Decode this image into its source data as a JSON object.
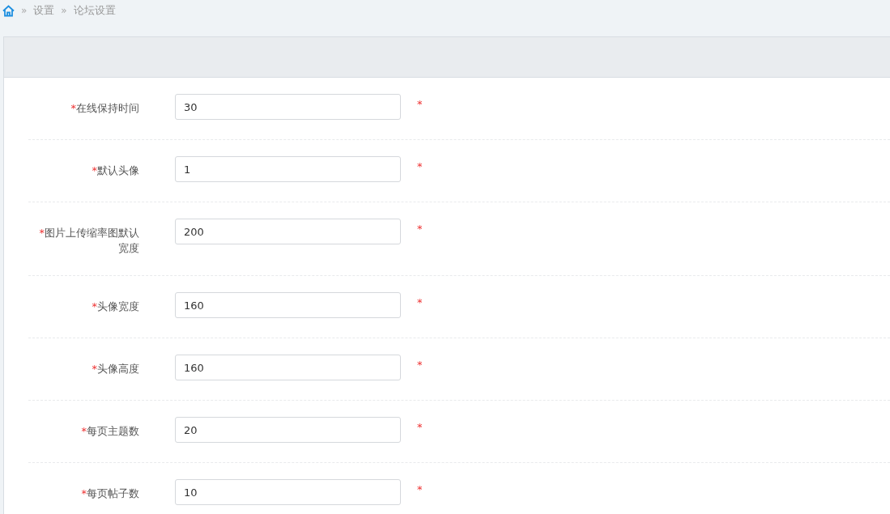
{
  "breadcrumb": {
    "items": [
      "设置",
      "论坛设置"
    ],
    "separator": "»"
  },
  "fields": [
    {
      "label": "在线保持时间",
      "value": "30",
      "required_mark": "*",
      "note": "*"
    },
    {
      "label": "默认头像",
      "value": "1",
      "required_mark": "*",
      "note": "*"
    },
    {
      "label": "图片上传缩率图默认宽度",
      "value": "200",
      "required_mark": "*",
      "note": "*"
    },
    {
      "label": "头像宽度",
      "value": "160",
      "required_mark": "*",
      "note": "*"
    },
    {
      "label": "头像高度",
      "value": "160",
      "required_mark": "*",
      "note": "*"
    },
    {
      "label": "每页主题数",
      "value": "20",
      "required_mark": "*",
      "note": "*"
    },
    {
      "label": "每页帖子数",
      "value": "10",
      "required_mark": "*",
      "note": "*"
    }
  ]
}
